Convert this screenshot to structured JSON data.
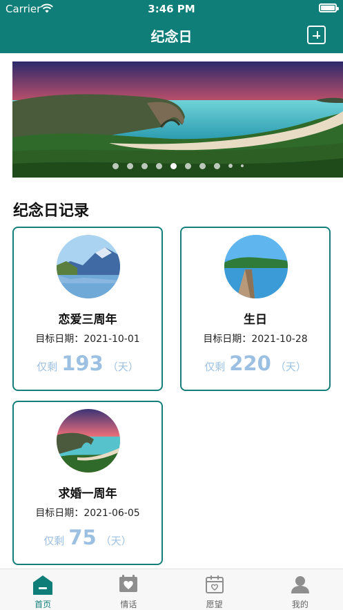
{
  "status_bar": {
    "carrier": "Carrier",
    "time": "3:46 PM"
  },
  "nav": {
    "title": "纪念日"
  },
  "banner": {
    "dot_count": 10,
    "active_dot_index": 4
  },
  "section": {
    "title": "纪念日记录"
  },
  "cards": [
    {
      "name": "恋爱三周年",
      "date_label": "目标日期：",
      "date": "2021-10-01",
      "prefix": "仅剩",
      "days": "193",
      "unit": "（天）"
    },
    {
      "name": "生日",
      "date_label": "目标日期：",
      "date": "2021-10-28",
      "prefix": "仅剩",
      "days": "220",
      "unit": "（天）"
    },
    {
      "name": "求婚一周年",
      "date_label": "目标日期：",
      "date": "2021-06-05",
      "prefix": "仅剩",
      "days": "75",
      "unit": "（天）"
    }
  ],
  "tabbar": {
    "tabs": [
      {
        "label": "首页",
        "active": true
      },
      {
        "label": "情话",
        "active": false
      },
      {
        "label": "愿望",
        "active": false
      },
      {
        "label": "我的",
        "active": false
      }
    ]
  },
  "colors": {
    "primary": "#0f7d78",
    "card_border": "#137e7a",
    "remain_text": "#9cc0e2"
  }
}
